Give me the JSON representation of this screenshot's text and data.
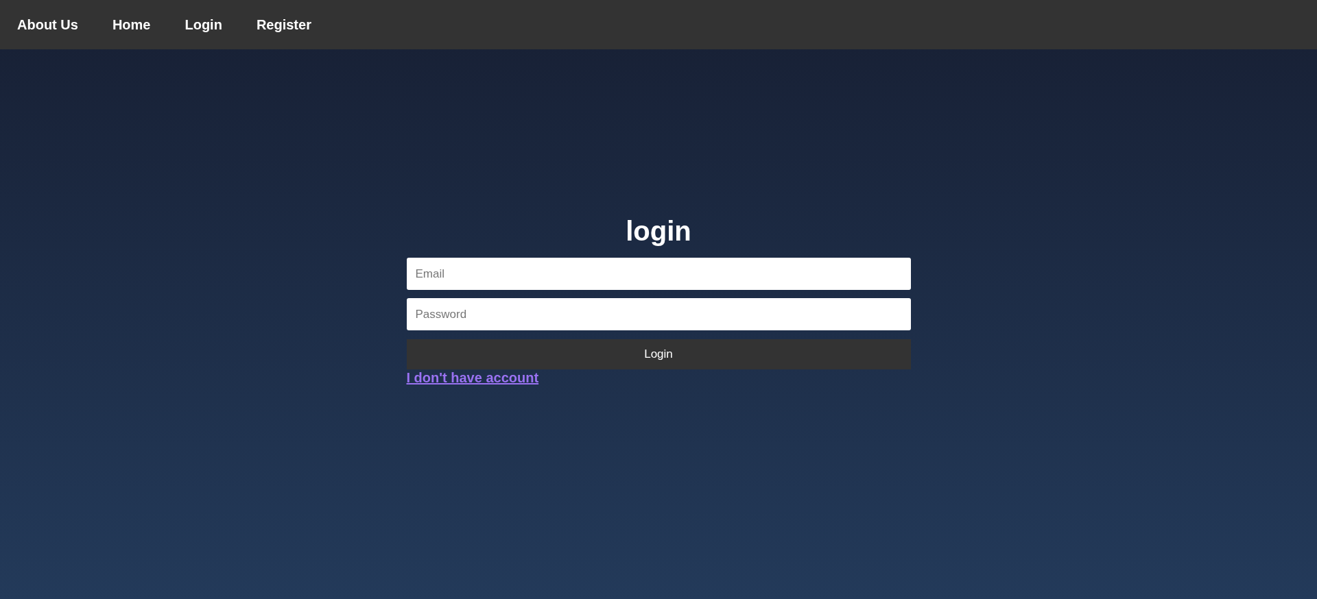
{
  "nav": {
    "items": [
      "About Us",
      "Home",
      "Login",
      "Register"
    ]
  },
  "form": {
    "title": "login",
    "email": {
      "placeholder": "Email"
    },
    "password": {
      "placeholder": "Password"
    },
    "submit": "Login",
    "register_link": "I don't have account"
  }
}
